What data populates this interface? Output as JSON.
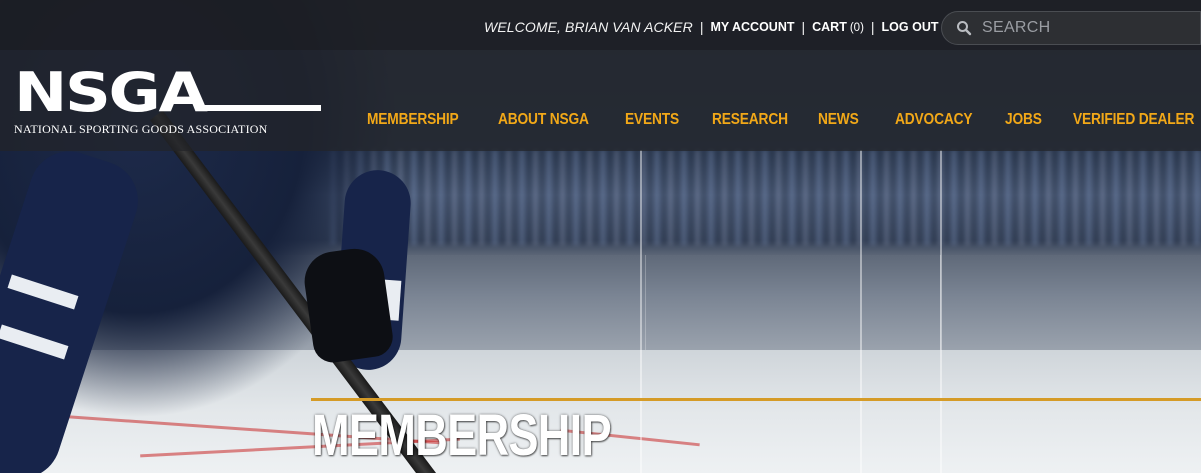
{
  "topbar": {
    "welcome": "WELCOME, BRIAN VAN ACKER",
    "separator": "|",
    "my_account": "MY ACCOUNT",
    "cart_label": "CART",
    "cart_count": "(0)",
    "log_out": "LOG OUT",
    "search_placeholder": "SEARCH"
  },
  "logo": {
    "mark": "NSGA",
    "subtitle": "NATIONAL SPORTING GOODS ASSOCIATION"
  },
  "nav": {
    "items": [
      {
        "label": "MEMBERSHIP"
      },
      {
        "label": "ABOUT NSGA"
      },
      {
        "label": "EVENTS"
      },
      {
        "label": "RESEARCH"
      },
      {
        "label": "NEWS"
      },
      {
        "label": "ADVOCACY"
      },
      {
        "label": "JOBS"
      },
      {
        "label": "VERIFIED DEALER"
      }
    ]
  },
  "page": {
    "title": "MEMBERSHIP"
  },
  "colors": {
    "accent": "#f2a818",
    "title_rule": "#d59b27",
    "topbar_bg": "#1c1e22"
  },
  "icons": {
    "search": "search-icon"
  }
}
